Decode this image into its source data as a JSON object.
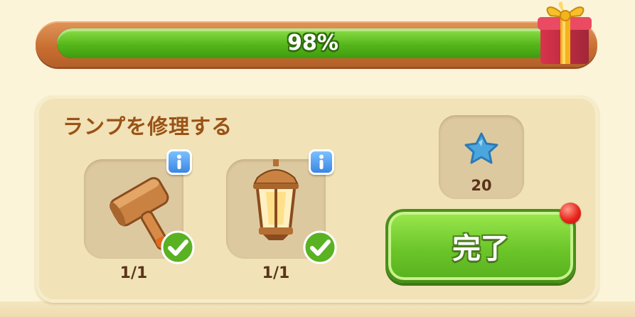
{
  "progress": {
    "label": "98%",
    "fraction": 0.98
  },
  "task": {
    "title": "ランプを修理する",
    "items": [
      {
        "icon": "wooden-mallet-icon",
        "count": "1/1",
        "complete": true
      },
      {
        "icon": "lantern-icon",
        "count": "1/1",
        "complete": true
      }
    ],
    "reward": {
      "icon": "blue-star-icon",
      "count": "20"
    },
    "complete_button": {
      "label": "完了"
    }
  },
  "colors": {
    "progress_green": "#55b61a",
    "frame_orange": "#c86d30",
    "panel_bg": "#f1e2b7",
    "title_brown": "#9a5216",
    "button_green": "#6cc62a",
    "info_blue": "#3a86e3",
    "notification_red": "#e8261c"
  }
}
